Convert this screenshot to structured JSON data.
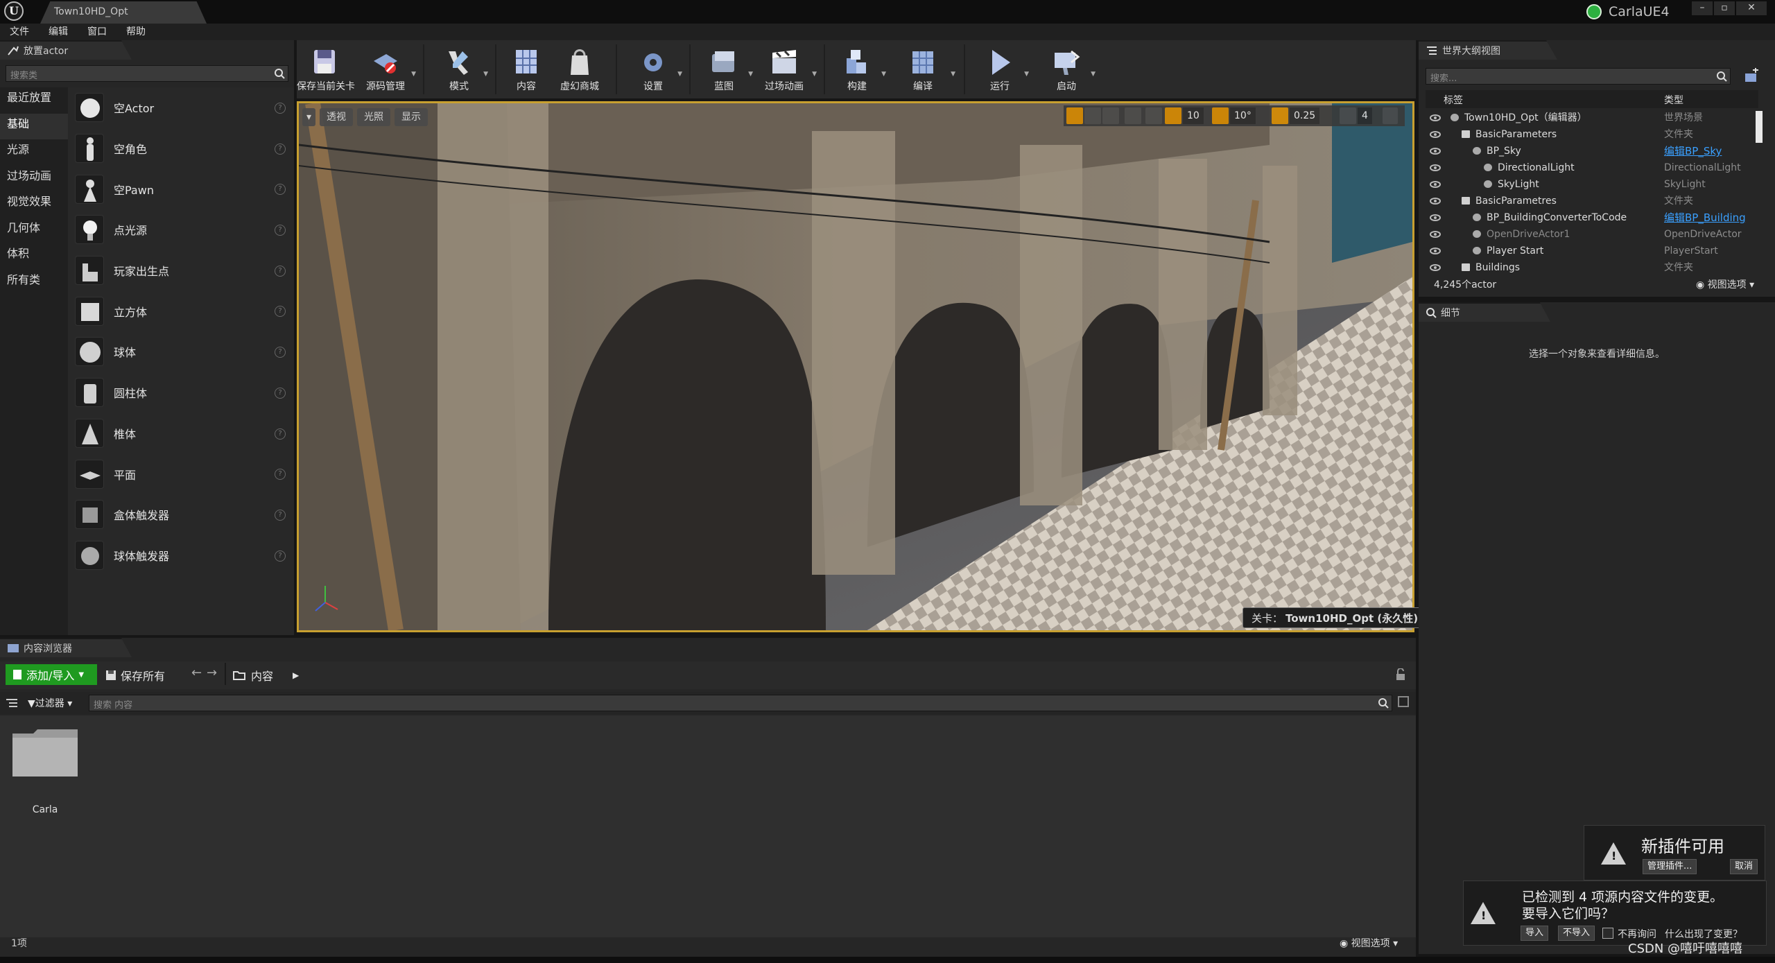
{
  "titlebar": {
    "doc_tab": "Town10HD_Opt",
    "project": "CarlaUE4",
    "logo": "U"
  },
  "menubar": [
    "文件",
    "编辑",
    "窗口",
    "帮助"
  ],
  "place_actors": {
    "tab": "放置actor",
    "search_placeholder": "搜索类",
    "categories": [
      "最近放置",
      "基础",
      "光源",
      "过场动画",
      "视觉效果",
      "几何体",
      "体积",
      "所有类"
    ],
    "selected_category": "基础",
    "items": [
      "空Actor",
      "空角色",
      "空Pawn",
      "点光源",
      "玩家出生点",
      "立方体",
      "球体",
      "圆柱体",
      "椎体",
      "平面",
      "盒体触发器",
      "球体触发器"
    ]
  },
  "toolbar": [
    {
      "label": "保存当前关卡",
      "icon": "save-icon"
    },
    {
      "label": "源码管理",
      "icon": "source-control-icon"
    },
    {
      "label": "模式",
      "icon": "modes-icon"
    },
    {
      "label": "内容",
      "icon": "content-icon"
    },
    {
      "label": "虚幻商城",
      "icon": "marketplace-icon"
    },
    {
      "label": "设置",
      "icon": "settings-icon"
    },
    {
      "label": "蓝图",
      "icon": "blueprint-icon"
    },
    {
      "label": "过场动画",
      "icon": "cinematics-icon"
    },
    {
      "label": "构建",
      "icon": "build-icon"
    },
    {
      "label": "编译",
      "icon": "compile-icon"
    },
    {
      "label": "运行",
      "icon": "play-icon"
    },
    {
      "label": "启动",
      "icon": "launch-icon"
    }
  ],
  "viewport": {
    "chips": [
      "透视",
      "光照",
      "显示"
    ],
    "grid_snap": "10",
    "rotation_snap": "10°",
    "scale_snap": "0.25",
    "camera_speed": "4",
    "level_prefix": "关卡：",
    "level_name": "Town10HD_Opt (永久性)"
  },
  "outliner": {
    "tab": "世界大纲视图",
    "search_placeholder": "搜索...",
    "col_label": "标签",
    "col_type": "类型",
    "rows": [
      {
        "name": "Town10HD_Opt（编辑器）",
        "type": "世界场景",
        "indent": 0,
        "link": false
      },
      {
        "name": "BasicParameters",
        "type": "文件夹",
        "indent": 1,
        "link": false
      },
      {
        "name": "BP_Sky",
        "type": "编辑BP_Sky",
        "indent": 2,
        "link": true
      },
      {
        "name": "DirectionalLight",
        "type": "DirectionalLight",
        "indent": 3,
        "link": false
      },
      {
        "name": "SkyLight",
        "type": "SkyLight",
        "indent": 3,
        "link": false
      },
      {
        "name": "BasicParametres",
        "type": "文件夹",
        "indent": 1,
        "link": false
      },
      {
        "name": "BP_BuildingConverterToCode",
        "type": "编辑BP_Building",
        "indent": 2,
        "link": true
      },
      {
        "name": "OpenDriveActor1",
        "type": "OpenDriveActor",
        "indent": 2,
        "link": false
      },
      {
        "name": "Player Start",
        "type": "PlayerStart",
        "indent": 2,
        "link": false
      },
      {
        "name": "Buildings",
        "type": "文件夹",
        "indent": 1,
        "link": false
      }
    ],
    "count": "4,245个actor",
    "view_options": "视图选项"
  },
  "details": {
    "tab": "细节",
    "empty_msg": "选择一个对象来查看详细信息。"
  },
  "content_browser": {
    "tab": "内容浏览器",
    "add_import": "添加/导入",
    "save_all": "保存所有",
    "path_root": "内容",
    "filter": "过滤器",
    "search_placeholder": "搜索 内容",
    "folders": [
      "Carla"
    ],
    "item_count": "1项",
    "view_options": "视图选项"
  },
  "notifications": {
    "plugin_title": "新插件可用",
    "plugin_manage": "管理插件...",
    "plugin_cancel": "取消",
    "import_msg_line1": "已检测到 4 项源内容文件的变更。",
    "import_msg_line2": "要导入它们吗？",
    "import_yes": "导入",
    "import_no": "不导入",
    "dont_ask": "不再询问",
    "whats_this": "什么出现了变更？"
  },
  "watermark": "CSDN @嘻吁嘻嘻嘻",
  "colors": {
    "accent_orange": "#d68a00",
    "add_green": "#1f9a20",
    "link_blue": "#3aa0ff",
    "viewport_border": "#c8a030"
  }
}
